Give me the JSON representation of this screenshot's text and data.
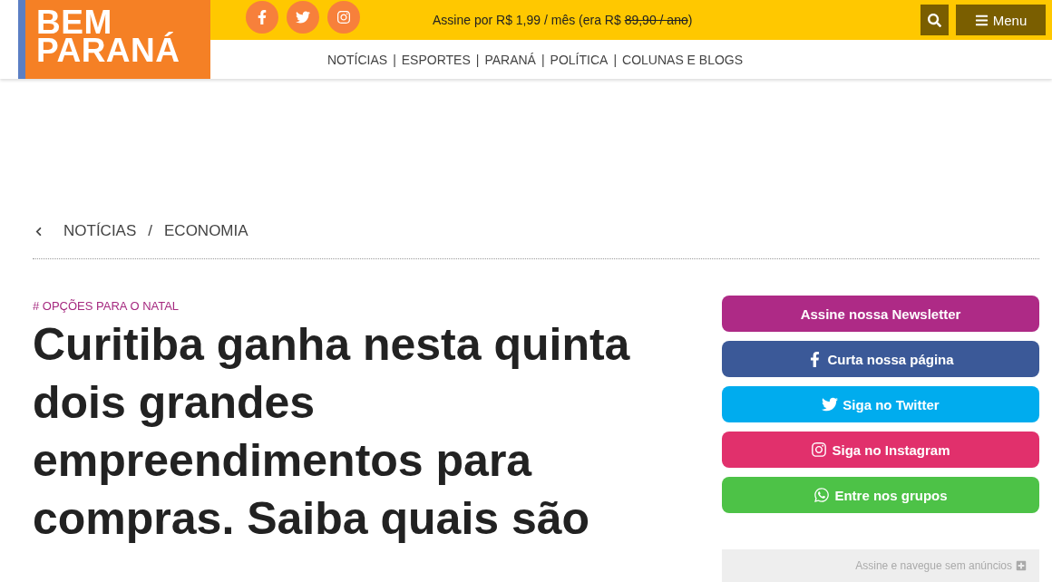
{
  "logo": {
    "lines": [
      "BEM",
      "PARANÁ"
    ]
  },
  "social_links": [
    {
      "kind": "facebook"
    },
    {
      "kind": "twitter"
    },
    {
      "kind": "instagram"
    }
  ],
  "promo": {
    "text_before": "Assine por R$ 1,99 / mês (era R$",
    "old_price": "89,90 / ano",
    "text_after": ")"
  },
  "menu_button": {
    "label": "Menu"
  },
  "nav": {
    "separator": "|",
    "items": [
      "NOTÍCIAS",
      "ESPORTES",
      "PARANÁ",
      "POLÍTICA",
      "COLUNAS E BLOGS"
    ]
  },
  "breadcrumb": {
    "separator": "/",
    "items": [
      "NOTÍCIAS",
      "ECONOMIA"
    ]
  },
  "article": {
    "tag": "# OPÇÕES PARA O NATAL",
    "headline": "Curitiba ganha nesta quinta dois grandes empreendimentos para compras. Saiba quais são"
  },
  "sidebar": {
    "buttons": [
      {
        "kind": "newsletter",
        "label": "Assine nossa Newsletter",
        "color": "#ae2a86"
      },
      {
        "kind": "facebook",
        "label": "Curta nossa página",
        "color": "#3b5998"
      },
      {
        "kind": "twitter",
        "label": "Siga no Twitter",
        "color": "#00acee"
      },
      {
        "kind": "instagram",
        "label": "Siga no Instagram",
        "color": "#e1306c"
      },
      {
        "kind": "whatsapp",
        "label": "Entre nos grupos",
        "color": "#4dc247"
      }
    ],
    "ad_free": {
      "label": "Assine e navegue sem anúncios"
    }
  }
}
